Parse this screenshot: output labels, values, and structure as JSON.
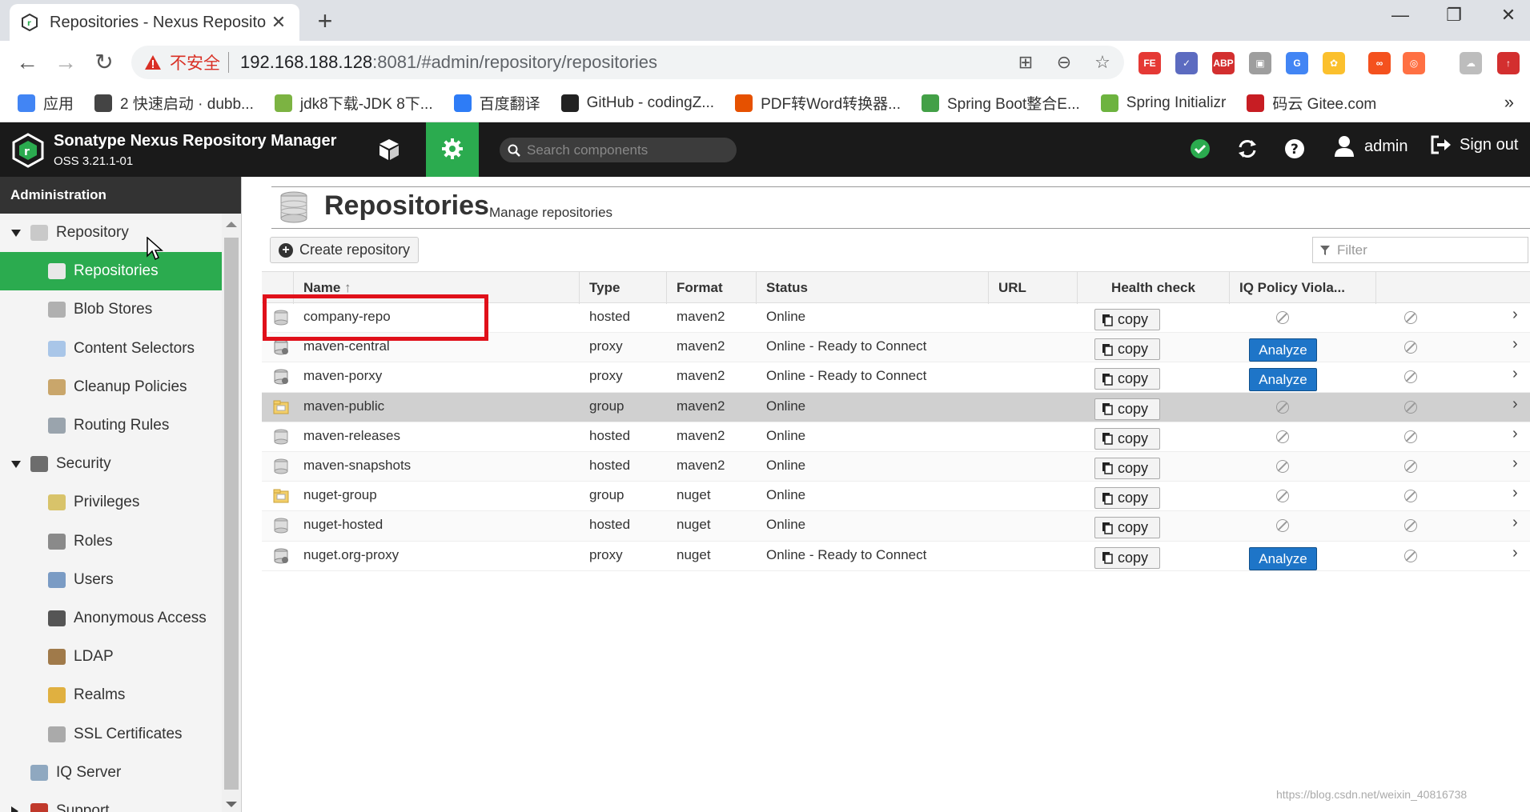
{
  "browser": {
    "tab_title": "Repositories - Nexus Reposito",
    "omnibox": {
      "security_label": "不安全",
      "url_host": "192.168.188.128",
      "url_rest": ":8081/#admin/repository/repositories"
    },
    "bookmarks": [
      {
        "label": "应用",
        "color": "#4285f4"
      },
      {
        "label": "2 快速启动 · dubb...",
        "color": "#444444"
      },
      {
        "label": "jdk8下载-JDK 8下...",
        "color": "#7cb342"
      },
      {
        "label": "百度翻译",
        "color": "#2e7cf6"
      },
      {
        "label": "GitHub - codingZ...",
        "color": "#222222"
      },
      {
        "label": "PDF转Word转换器...",
        "color": "#e65100"
      },
      {
        "label": "Spring Boot整合E...",
        "color": "#43a047"
      },
      {
        "label": "Spring Initializr",
        "color": "#6db33f"
      },
      {
        "label": "码云 Gitee.com",
        "color": "#c71d23"
      }
    ],
    "extensions": [
      {
        "label": "FE",
        "color": "#e53935"
      },
      {
        "label": "✓",
        "color": "#5c6bc0"
      },
      {
        "label": "ABP",
        "color": "#d32f2f"
      },
      {
        "label": "▣",
        "color": "#9e9e9e"
      },
      {
        "label": "G",
        "color": "#4285f4"
      },
      {
        "label": "✿",
        "color": "#fbc02d"
      },
      {
        "label": "∞",
        "color": "#f4511e"
      },
      {
        "label": "◎",
        "color": "#ff7043"
      },
      {
        "label": "☁",
        "color": "#bdbdbd"
      },
      {
        "label": "↑",
        "color": "#d32f2f"
      }
    ]
  },
  "header": {
    "product": "Sonatype Nexus Repository Manager",
    "version": "OSS 3.21.1-01",
    "search_placeholder": "Search components",
    "user": "admin",
    "sign_out": "Sign out",
    "brand_green": "#2bab4f"
  },
  "sidebar": {
    "title": "Administration",
    "items": [
      {
        "label": "Repository",
        "level": 1,
        "expanded": true,
        "icon": "database-icon"
      },
      {
        "label": "Repositories",
        "level": 2,
        "active": true,
        "icon": "database-icon"
      },
      {
        "label": "Blob Stores",
        "level": 2,
        "icon": "drive-icon"
      },
      {
        "label": "Content Selectors",
        "level": 2,
        "icon": "selector-icon"
      },
      {
        "label": "Cleanup Policies",
        "level": 2,
        "icon": "broom-icon"
      },
      {
        "label": "Routing Rules",
        "level": 2,
        "icon": "route-icon"
      },
      {
        "label": "Security",
        "level": 1,
        "expanded": true,
        "icon": "security-icon"
      },
      {
        "label": "Privileges",
        "level": 2,
        "icon": "medal-icon"
      },
      {
        "label": "Roles",
        "level": 2,
        "icon": "role-icon"
      },
      {
        "label": "Users",
        "level": 2,
        "icon": "users-icon"
      },
      {
        "label": "Anonymous Access",
        "level": 2,
        "icon": "id-card-icon"
      },
      {
        "label": "LDAP",
        "level": 2,
        "icon": "book-icon"
      },
      {
        "label": "Realms",
        "level": 2,
        "icon": "shield-icon"
      },
      {
        "label": "SSL Certificates",
        "level": 2,
        "icon": "certificate-icon"
      },
      {
        "label": "IQ Server",
        "level": 1,
        "icon": "iq-icon"
      },
      {
        "label": "Support",
        "level": 1,
        "collapsed": true,
        "icon": "support-icon"
      }
    ]
  },
  "page": {
    "title": "Repositories",
    "subtitle": "Manage repositories",
    "create_label": "Create repository",
    "filter_placeholder": "Filter"
  },
  "table": {
    "columns": [
      "Name",
      "Type",
      "Format",
      "Status",
      "URL",
      "Health check",
      "IQ Policy Viola..."
    ],
    "copy_label": "copy",
    "analyze_label": "Analyze",
    "rows": [
      {
        "name": "company-repo",
        "type": "hosted",
        "format": "maven2",
        "status": "Online",
        "health": "na",
        "icon": "hosted-repo-icon"
      },
      {
        "name": "maven-central",
        "type": "proxy",
        "format": "maven2",
        "status": "Online - Ready to Connect",
        "health": "analyze",
        "icon": "proxy-repo-icon"
      },
      {
        "name": "maven-porxy",
        "type": "proxy",
        "format": "maven2",
        "status": "Online - Ready to Connect",
        "health": "analyze",
        "icon": "proxy-repo-icon"
      },
      {
        "name": "maven-public",
        "type": "group",
        "format": "maven2",
        "status": "Online",
        "health": "na",
        "icon": "group-repo-icon",
        "selected": true
      },
      {
        "name": "maven-releases",
        "type": "hosted",
        "format": "maven2",
        "status": "Online",
        "health": "na",
        "icon": "hosted-repo-icon"
      },
      {
        "name": "maven-snapshots",
        "type": "hosted",
        "format": "maven2",
        "status": "Online",
        "health": "na",
        "icon": "hosted-repo-icon"
      },
      {
        "name": "nuget-group",
        "type": "group",
        "format": "nuget",
        "status": "Online",
        "health": "na",
        "icon": "group-repo-icon"
      },
      {
        "name": "nuget-hosted",
        "type": "hosted",
        "format": "nuget",
        "status": "Online",
        "health": "na",
        "icon": "hosted-repo-icon"
      },
      {
        "name": "nuget.org-proxy",
        "type": "proxy",
        "format": "nuget",
        "status": "Online - Ready to Connect",
        "health": "analyze",
        "icon": "proxy-repo-icon"
      }
    ]
  },
  "watermark": "https://blog.csdn.net/weixin_40816738"
}
